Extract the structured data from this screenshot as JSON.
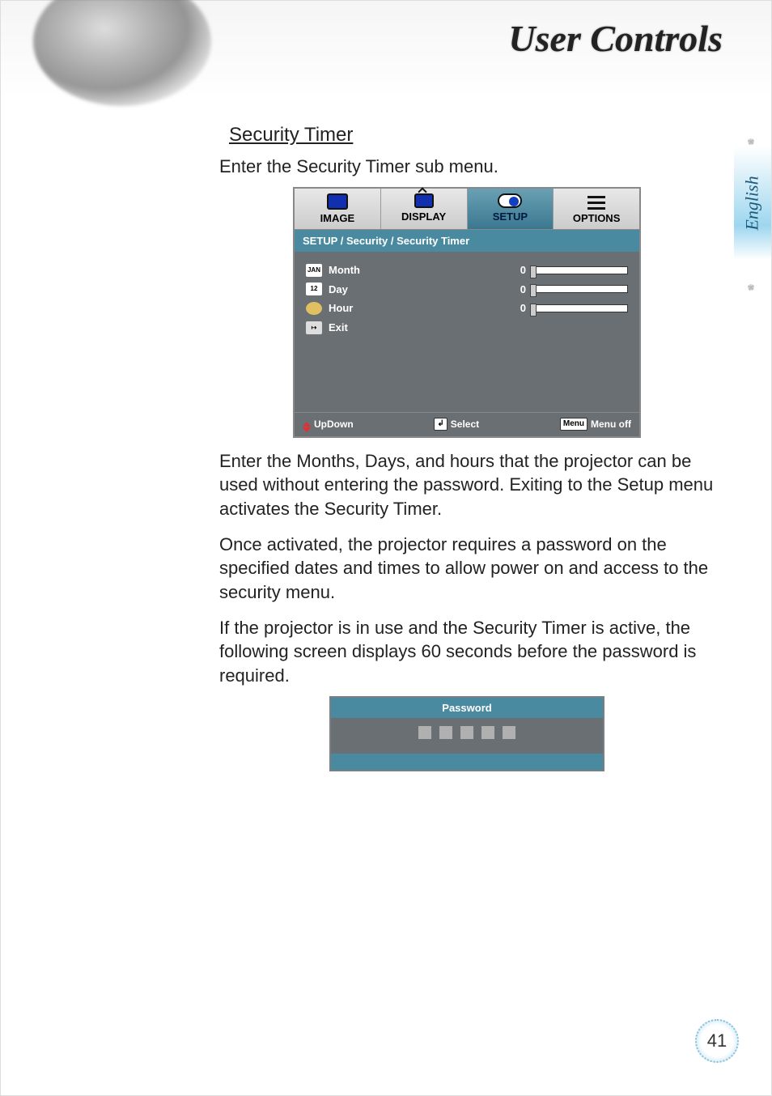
{
  "page_title": "User Controls",
  "section_heading": "Security Timer",
  "intro": "Enter the Security Timer sub menu.",
  "paragraphs": [
    "Enter the Months, Days, and hours that the projector can be used without entering the password. Exiting to the Setup menu activates the Security Timer.",
    "Once activated, the projector requires a password on the specified dates and times to allow power on and access to the security menu.",
    "If the projector is in use and the Security Timer is active, the following screen displays 60 seconds before the password is required."
  ],
  "osd": {
    "tabs": [
      "IMAGE",
      "DISPLAY",
      "SETUP",
      "OPTIONS"
    ],
    "active_tab_index": 2,
    "breadcrumb": "SETUP / Security / Security Timer",
    "items": [
      {
        "icon": "JAN",
        "label": "Month",
        "value": "0",
        "has_slider": true
      },
      {
        "icon": "12",
        "label": "Day",
        "value": "0",
        "has_slider": true
      },
      {
        "icon": "clock",
        "label": "Hour",
        "value": "0",
        "has_slider": true
      },
      {
        "icon": "exit",
        "label": "Exit",
        "value": "",
        "has_slider": false
      }
    ],
    "footer": {
      "updown": "UpDown",
      "select": "Select",
      "menu_key": "Menu",
      "menuoff": "Menu off"
    }
  },
  "password_box": {
    "title": "Password",
    "dots": 5
  },
  "side_tab": "English",
  "page_number": "41"
}
